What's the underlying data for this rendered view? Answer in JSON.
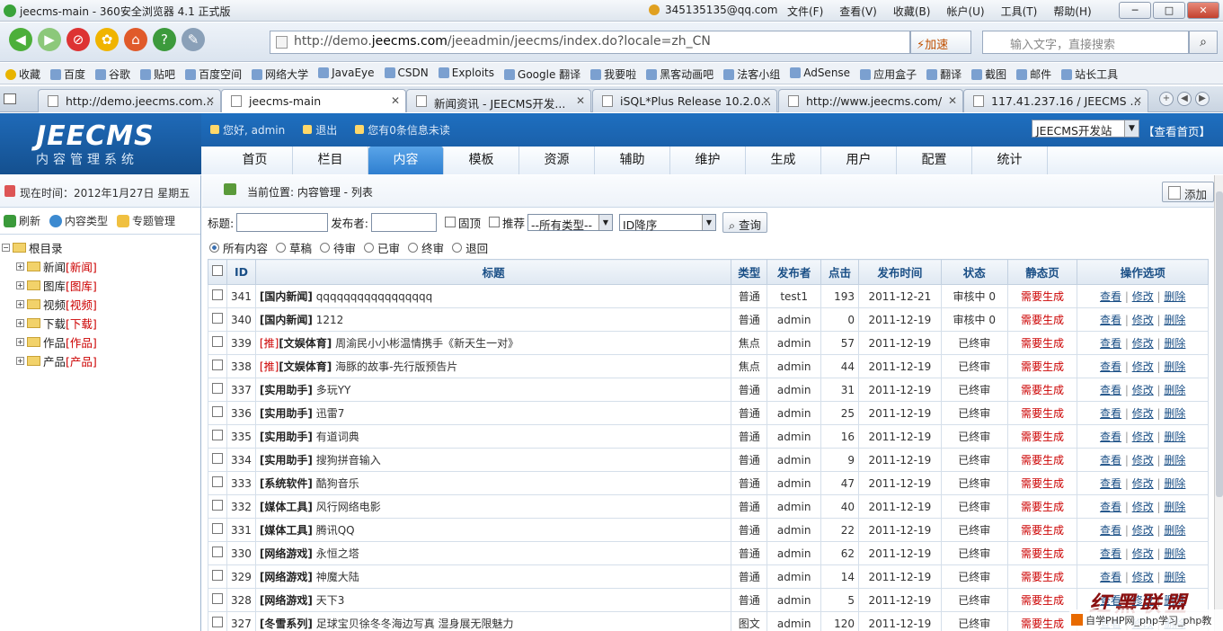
{
  "titlebar": {
    "title": "jeecms-main - 360安全浏览器 4.1 正式版",
    "user": "345135135@qq.com",
    "menu": [
      "文件(F)",
      "查看(V)",
      "收藏(B)",
      "帐户(U)",
      "工具(T)",
      "帮助(H)"
    ]
  },
  "navbar": {
    "url_prefix": "http://demo.",
    "url_domain": "jeecms.com",
    "url_suffix": "/jeeadmin/jeecms/index.do?locale=zh_CN",
    "accel": "⚡加速",
    "search_placeholder": "输入文字，直接搜索"
  },
  "favorites": [
    "收藏",
    "百度",
    "谷歌",
    "贴吧",
    "百度空间",
    "网络大学",
    "JavaEye",
    "CSDN",
    "Exploits",
    "Google 翻译",
    "我要啦",
    "黑客动画吧",
    "法客小组",
    "AdSense",
    "应用盒子",
    "翻译",
    "截图",
    "邮件",
    "站长工具"
  ],
  "tabs": [
    {
      "label": "http://demo.jeecms.com..."
    },
    {
      "label": "jeecms-main"
    },
    {
      "label": "新闻资讯 - JEECMS开发..."
    },
    {
      "label": "iSQL*Plus Release 10.2.0..."
    },
    {
      "label": "http://www.jeecms.com/"
    },
    {
      "label": "117.41.237.16 / JEECMS ..."
    }
  ],
  "header": {
    "logo": "JEECMS",
    "logo_sub": "内容管理系统",
    "greeting": "您好, admin",
    "logout": "退出",
    "messages": "您有0条信息未读",
    "site": "JEECMS开发站",
    "view_home": "【查看首页】"
  },
  "mainnav": [
    "首页",
    "栏目",
    "内容",
    "模板",
    "资源",
    "辅助",
    "维护",
    "生成",
    "用户",
    "配置",
    "统计"
  ],
  "sidebar": {
    "time": "现在时间：2012年1月27日 星期五",
    "refresh": "刷新",
    "content_type": "内容类型",
    "topic": "专题管理",
    "root": "根目录",
    "nodes": [
      {
        "name": "新闻",
        "tag": "[新闻]"
      },
      {
        "name": "图库",
        "tag": "[图库]"
      },
      {
        "name": "视频",
        "tag": "[视频]"
      },
      {
        "name": "下载",
        "tag": "[下载]"
      },
      {
        "name": "作品",
        "tag": "[作品]"
      },
      {
        "name": "产品",
        "tag": "[产品]"
      }
    ]
  },
  "content": {
    "crumb": "当前位置: 内容管理 - 列表",
    "add": "添加",
    "filter": {
      "title_label": "标题:",
      "publisher_label": "发布者:",
      "top": "固顶",
      "recommend": "推荐",
      "type": "--所有类型--",
      "order": "ID降序",
      "query": "查询"
    },
    "status_radios": [
      "所有内容",
      "草稿",
      "待审",
      "已审",
      "终审",
      "退回"
    ],
    "columns": [
      "ID",
      "标题",
      "类型",
      "发布者",
      "点击",
      "发布时间",
      "状态",
      "静态页",
      "操作选项"
    ],
    "ops": {
      "view": "查看",
      "edit": "修改",
      "delete": "删除"
    },
    "rows": [
      {
        "id": "341",
        "rec": "",
        "cat": "[国内新闻]",
        "title": "qqqqqqqqqqqqqqqqq",
        "type": "普通",
        "pub": "test1",
        "clicks": "193",
        "date": "2011-12-21",
        "status": "审核中 0",
        "static": "需要生成"
      },
      {
        "id": "340",
        "rec": "",
        "cat": "[国内新闻]",
        "title": "1212",
        "type": "普通",
        "pub": "admin",
        "clicks": "0",
        "date": "2011-12-19",
        "status": "审核中 0",
        "static": "需要生成"
      },
      {
        "id": "339",
        "rec": "[推]",
        "cat": "[文娱体育]",
        "title": "周渝民小小彬温情携手《新天生一对》",
        "type": "焦点",
        "pub": "admin",
        "clicks": "57",
        "date": "2011-12-19",
        "status": "已终审",
        "static": "需要生成"
      },
      {
        "id": "338",
        "rec": "[推]",
        "cat": "[文娱体育]",
        "title": "海豚的故事-先行版预告片",
        "type": "焦点",
        "pub": "admin",
        "clicks": "44",
        "date": "2011-12-19",
        "status": "已终审",
        "static": "需要生成"
      },
      {
        "id": "337",
        "rec": "",
        "cat": "[实用助手]",
        "title": "多玩YY",
        "type": "普通",
        "pub": "admin",
        "clicks": "31",
        "date": "2011-12-19",
        "status": "已终审",
        "static": "需要生成"
      },
      {
        "id": "336",
        "rec": "",
        "cat": "[实用助手]",
        "title": "迅雷7",
        "type": "普通",
        "pub": "admin",
        "clicks": "25",
        "date": "2011-12-19",
        "status": "已终审",
        "static": "需要生成"
      },
      {
        "id": "335",
        "rec": "",
        "cat": "[实用助手]",
        "title": "有道词典",
        "type": "普通",
        "pub": "admin",
        "clicks": "16",
        "date": "2011-12-19",
        "status": "已终审",
        "static": "需要生成"
      },
      {
        "id": "334",
        "rec": "",
        "cat": "[实用助手]",
        "title": "搜狗拼音输入",
        "type": "普通",
        "pub": "admin",
        "clicks": "9",
        "date": "2011-12-19",
        "status": "已终审",
        "static": "需要生成"
      },
      {
        "id": "333",
        "rec": "",
        "cat": "[系统软件]",
        "title": "酷狗音乐",
        "type": "普通",
        "pub": "admin",
        "clicks": "47",
        "date": "2011-12-19",
        "status": "已终审",
        "static": "需要生成"
      },
      {
        "id": "332",
        "rec": "",
        "cat": "[媒体工具]",
        "title": "风行网络电影",
        "type": "普通",
        "pub": "admin",
        "clicks": "40",
        "date": "2011-12-19",
        "status": "已终审",
        "static": "需要生成"
      },
      {
        "id": "331",
        "rec": "",
        "cat": "[媒体工具]",
        "title": "腾讯QQ",
        "type": "普通",
        "pub": "admin",
        "clicks": "22",
        "date": "2011-12-19",
        "status": "已终审",
        "static": "需要生成"
      },
      {
        "id": "330",
        "rec": "",
        "cat": "[网络游戏]",
        "title": "永恒之塔",
        "type": "普通",
        "pub": "admin",
        "clicks": "62",
        "date": "2011-12-19",
        "status": "已终审",
        "static": "需要生成"
      },
      {
        "id": "329",
        "rec": "",
        "cat": "[网络游戏]",
        "title": "神魔大陆",
        "type": "普通",
        "pub": "admin",
        "clicks": "14",
        "date": "2011-12-19",
        "status": "已终审",
        "static": "需要生成"
      },
      {
        "id": "328",
        "rec": "",
        "cat": "[网络游戏]",
        "title": "天下3",
        "type": "普通",
        "pub": "admin",
        "clicks": "5",
        "date": "2011-12-19",
        "status": "已终审",
        "static": "需要生成"
      },
      {
        "id": "327",
        "rec": "",
        "cat": "[冬雪系列]",
        "title": "足球宝贝徐冬冬海边写真 湿身展无限魅力",
        "type": "图文",
        "pub": "admin",
        "clicks": "120",
        "date": "2011-12-19",
        "status": "已终审",
        "static": "需要生成"
      }
    ]
  },
  "watermark": {
    "big": "红黑联盟",
    "small": "自学PHP网_php学习_php教"
  }
}
